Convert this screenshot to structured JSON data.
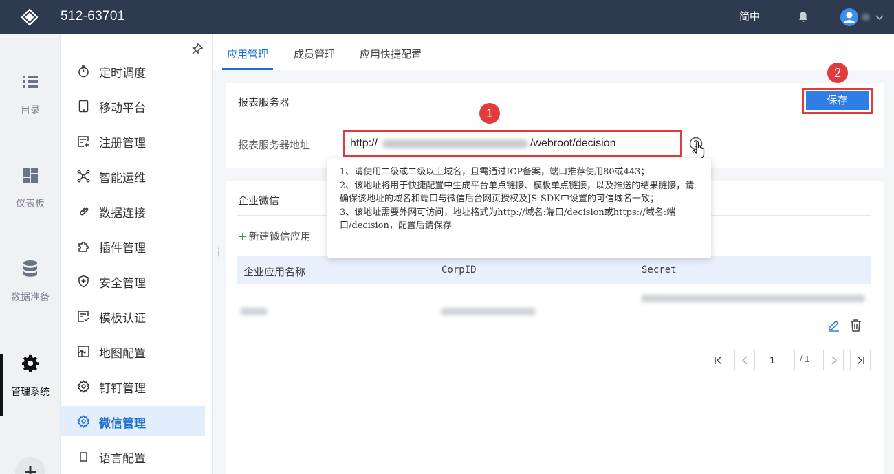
{
  "header": {
    "title": "512-63701",
    "lang": "简中"
  },
  "rail": {
    "items": [
      {
        "label": "目录",
        "icon": "list-icon"
      },
      {
        "label": "仪表板",
        "icon": "dashboard-icon"
      },
      {
        "label": "数据准备",
        "icon": "database-icon"
      },
      {
        "label": "管理系统",
        "icon": "gear-icon",
        "active": true
      }
    ]
  },
  "submenu": {
    "items": [
      {
        "label": "定时调度",
        "icon": "stopwatch-icon"
      },
      {
        "label": "移动平台",
        "icon": "tablet-icon"
      },
      {
        "label": "注册管理",
        "icon": "register-icon"
      },
      {
        "label": "智能运维",
        "icon": "network-icon"
      },
      {
        "label": "数据连接",
        "icon": "link-icon"
      },
      {
        "label": "插件管理",
        "icon": "puzzle-icon"
      },
      {
        "label": "安全管理",
        "icon": "shield-icon"
      },
      {
        "label": "模板认证",
        "icon": "template-icon"
      },
      {
        "label": "地图配置",
        "icon": "map-icon"
      },
      {
        "label": "钉钉管理",
        "icon": "cog-icon"
      },
      {
        "label": "微信管理",
        "icon": "cog-icon",
        "active": true
      },
      {
        "label": "语言配置",
        "icon": "doc-icon"
      }
    ]
  },
  "tabs": [
    {
      "label": "应用管理",
      "active": true
    },
    {
      "label": "成员管理"
    },
    {
      "label": "应用快捷配置"
    }
  ],
  "server_card": {
    "title": "报表服务器",
    "save_label": "保存",
    "field_label": "报表服务器地址",
    "url_prefix": "http://",
    "url_suffix": "/webroot/decision"
  },
  "badges": {
    "one": "1",
    "two": "2"
  },
  "tooltip": {
    "line1": "1、请使用二级或二级以上域名，且需通过ICP备案，端口推荐使用80或443；",
    "line2": "2、该地址将用于快捷配置中生成平台单点链接、模板单点链接，以及推送的结果链接，请确保该地址的域名和端口与微信后台网页授权及JS-SDK中设置的可信域名一致；",
    "line3": "3、该地址需要外网可访问，地址格式为http://域名:端口/decision或https://域名:端口/decision，配置后请保存"
  },
  "wechat_card": {
    "title": "企业微信",
    "new_app_label": "新建微信应用",
    "columns": [
      "企业应用名称",
      "CorpID",
      "Secret"
    ]
  },
  "pagination": {
    "current": "1",
    "total": "/ 1"
  },
  "colors": {
    "accent": "#1d6fd4",
    "topbar": "#2e3a4f",
    "highlight": "#e23b3b"
  }
}
